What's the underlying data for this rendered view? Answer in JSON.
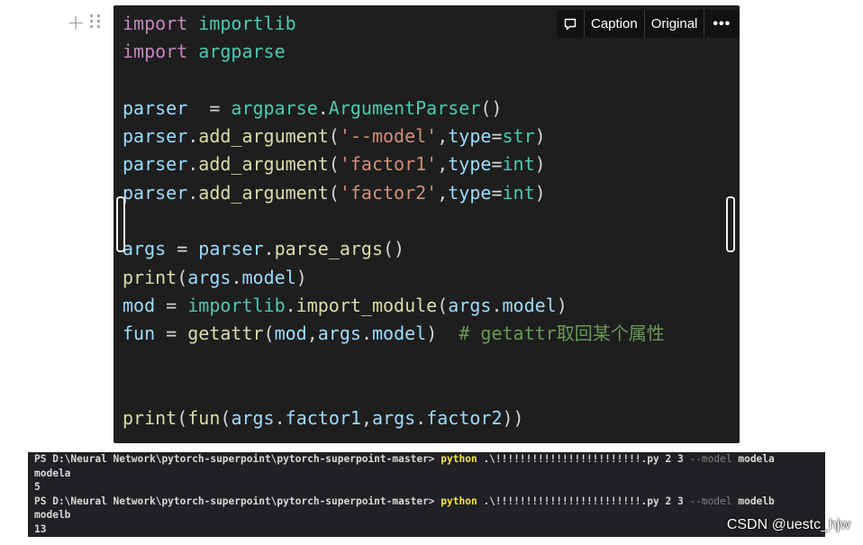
{
  "block_handles": {
    "add_icon": "plus-icon",
    "drag_icon": "drag-handle-icon"
  },
  "toolbar": {
    "comment_icon": "comment-icon",
    "caption_label": "Caption",
    "original_label": "Original",
    "more_label": "•••"
  },
  "code": {
    "lines": [
      [
        [
          "kw",
          "import"
        ],
        [
          "punc",
          " "
        ],
        [
          "mod",
          "importlib"
        ]
      ],
      [
        [
          "kw",
          "import"
        ],
        [
          "punc",
          " "
        ],
        [
          "mod",
          "argparse"
        ]
      ],
      [],
      [
        [
          "var",
          "parser"
        ],
        [
          "punc",
          "  = "
        ],
        [
          "mod",
          "argparse"
        ],
        [
          "punc",
          "."
        ],
        [
          "mod",
          "ArgumentParser"
        ],
        [
          "punc",
          "()"
        ]
      ],
      [
        [
          "var",
          "parser"
        ],
        [
          "punc",
          "."
        ],
        [
          "fn",
          "add_argument"
        ],
        [
          "punc",
          "("
        ],
        [
          "str",
          "'--model'"
        ],
        [
          "punc",
          ","
        ],
        [
          "var",
          "type"
        ],
        [
          "punc",
          "="
        ],
        [
          "bt",
          "str"
        ],
        [
          "punc",
          ")"
        ]
      ],
      [
        [
          "var",
          "parser"
        ],
        [
          "punc",
          "."
        ],
        [
          "fn",
          "add_argument"
        ],
        [
          "punc",
          "("
        ],
        [
          "str",
          "'factor1'"
        ],
        [
          "punc",
          ","
        ],
        [
          "var",
          "type"
        ],
        [
          "punc",
          "="
        ],
        [
          "bt",
          "int"
        ],
        [
          "punc",
          ")"
        ]
      ],
      [
        [
          "var",
          "parser"
        ],
        [
          "punc",
          "."
        ],
        [
          "fn",
          "add_argument"
        ],
        [
          "punc",
          "("
        ],
        [
          "str",
          "'factor2'"
        ],
        [
          "punc",
          ","
        ],
        [
          "var",
          "type"
        ],
        [
          "punc",
          "="
        ],
        [
          "bt",
          "int"
        ],
        [
          "punc",
          ")"
        ]
      ],
      [],
      [
        [
          "var",
          "args"
        ],
        [
          "punc",
          " = "
        ],
        [
          "var",
          "parser"
        ],
        [
          "punc",
          "."
        ],
        [
          "fn",
          "parse_args"
        ],
        [
          "punc",
          "()"
        ]
      ],
      [
        [
          "fn",
          "print"
        ],
        [
          "punc",
          "("
        ],
        [
          "var",
          "args"
        ],
        [
          "punc",
          "."
        ],
        [
          "var",
          "model"
        ],
        [
          "punc",
          ")"
        ]
      ],
      [
        [
          "var",
          "mod"
        ],
        [
          "punc",
          " = "
        ],
        [
          "mod",
          "importlib"
        ],
        [
          "punc",
          "."
        ],
        [
          "fn",
          "import_module"
        ],
        [
          "punc",
          "("
        ],
        [
          "var",
          "args"
        ],
        [
          "punc",
          "."
        ],
        [
          "var",
          "model"
        ],
        [
          "punc",
          ")"
        ]
      ],
      [
        [
          "var",
          "fun"
        ],
        [
          "punc",
          " = "
        ],
        [
          "fn",
          "getattr"
        ],
        [
          "punc",
          "("
        ],
        [
          "var",
          "mod"
        ],
        [
          "punc",
          ","
        ],
        [
          "var",
          "args"
        ],
        [
          "punc",
          "."
        ],
        [
          "var",
          "model"
        ],
        [
          "punc",
          ")  "
        ],
        [
          "cmt",
          "# getattr取回某个属性"
        ]
      ],
      [],
      [],
      [
        [
          "fn",
          "print"
        ],
        [
          "punc",
          "("
        ],
        [
          "fn",
          "fun"
        ],
        [
          "punc",
          "("
        ],
        [
          "var",
          "args"
        ],
        [
          "punc",
          "."
        ],
        [
          "var",
          "factor1"
        ],
        [
          "punc",
          ","
        ],
        [
          "var",
          "args"
        ],
        [
          "punc",
          "."
        ],
        [
          "var",
          "factor2"
        ],
        [
          "punc",
          "))"
        ]
      ]
    ]
  },
  "terminal": {
    "lines": [
      [
        [
          "plain",
          "PS D:\\Neural Network\\pytorch-superpoint\\pytorch-superpoint-master> "
        ],
        [
          "cmd",
          "python"
        ],
        [
          "plain",
          " .\\!!!!!!!!!!!!!!!!!!!!!!!!.py 2 3 "
        ],
        [
          "flag",
          "--model"
        ],
        [
          "plain",
          " modela"
        ]
      ],
      [
        [
          "plain",
          "modela"
        ]
      ],
      [
        [
          "plain",
          "5"
        ]
      ],
      [
        [
          "plain",
          "PS D:\\Neural Network\\pytorch-superpoint\\pytorch-superpoint-master> "
        ],
        [
          "cmd",
          "python"
        ],
        [
          "plain",
          " .\\!!!!!!!!!!!!!!!!!!!!!!!!.py 2 3 "
        ],
        [
          "flag",
          "--model"
        ],
        [
          "plain",
          " modelb"
        ]
      ],
      [
        [
          "plain",
          "modelb"
        ]
      ],
      [
        [
          "plain",
          "13"
        ]
      ]
    ]
  },
  "watermark": "CSDN @uestc_hjw"
}
